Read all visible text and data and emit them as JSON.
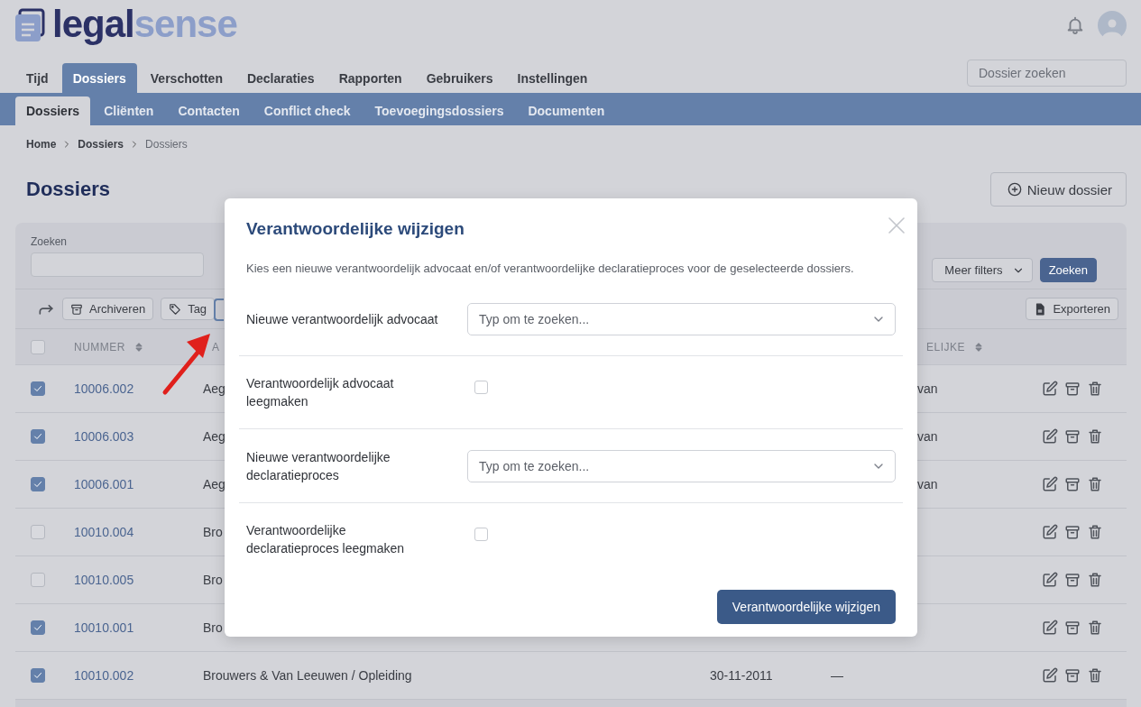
{
  "header": {
    "logo": {
      "text_1": "legal",
      "text_2": "sense"
    },
    "search": {
      "placeholder": "Dossier zoeken"
    }
  },
  "main_nav": [
    {
      "label": "Tijd",
      "selected": false
    },
    {
      "label": "Dossiers",
      "selected": true
    },
    {
      "label": "Verschotten",
      "selected": false
    },
    {
      "label": "Declaraties",
      "selected": false
    },
    {
      "label": "Rapporten",
      "selected": false
    },
    {
      "label": "Gebruikers",
      "selected": false
    },
    {
      "label": "Instellingen",
      "selected": false
    }
  ],
  "sub_nav": [
    {
      "label": "Dossiers",
      "selected": true
    },
    {
      "label": "Cliënten",
      "selected": false
    },
    {
      "label": "Contacten",
      "selected": false
    },
    {
      "label": "Conflict check",
      "selected": false
    },
    {
      "label": "Toevoegingsdossiers",
      "selected": false
    },
    {
      "label": "Documenten",
      "selected": false
    }
  ],
  "breadcrumb": [
    {
      "label": "Home",
      "current": false
    },
    {
      "label": "Dossiers",
      "current": false
    },
    {
      "label": "Dossiers",
      "current": true
    }
  ],
  "page": {
    "title": "Dossiers",
    "new_button": "Nieuw dossier"
  },
  "filters": {
    "search_label": "Zoeken",
    "more_filters": "Meer filters",
    "search_button": "Zoeken"
  },
  "toolbar": {
    "buttons": [
      {
        "kind": "archive",
        "label": "Archiveren"
      },
      {
        "kind": "tag",
        "label": "Tag"
      }
    ],
    "export": "Exporteren"
  },
  "table": {
    "all_checked": false,
    "columns": [
      {
        "label": "NUMMER",
        "sortable": true
      },
      {
        "label": "A",
        "sortable": false
      },
      {
        "label": "ELIJKE",
        "sortable": true
      }
    ],
    "rows": [
      {
        "checked": true,
        "number": "10006.002",
        "column_2": "Aeg",
        "column_4": "van"
      },
      {
        "checked": true,
        "number": "10006.003",
        "column_2": "Aeg",
        "column_4": "van"
      },
      {
        "checked": true,
        "number": "10006.001",
        "column_2": "Aeg",
        "column_4": "van"
      },
      {
        "checked": false,
        "number": "10010.004",
        "column_2": "Bro"
      },
      {
        "checked": false,
        "number": "10010.005",
        "column_2": "Bro"
      },
      {
        "checked": true,
        "number": "10010.001",
        "column_2": "Bro"
      },
      {
        "checked": true,
        "number": "10010.002",
        "column_2": "Brouwers & Van Leeuwen / Opleiding",
        "column_3": "30-11-2011",
        "column_4": "—"
      }
    ]
  },
  "modal": {
    "title": "Verantwoordelijke wijzigen",
    "description": "Kies een nieuwe verantwoordelijk advocaat en/of verantwoordelijke declaratieproces voor de geselecteerde dossiers.",
    "fields": [
      {
        "kind": "select",
        "label": "Nieuwe verantwoordelijk advocaat",
        "placeholder": "Typ om te zoeken..."
      },
      {
        "kind": "checkbox",
        "label": "Verantwoordelijk advocaat leegmaken",
        "checked": false
      },
      {
        "kind": "select",
        "label": "Nieuwe verantwoordelijke declaratieproces",
        "placeholder": "Typ om te zoeken..."
      },
      {
        "kind": "checkbox",
        "label": "Verantwoordelijke declaratieproces leegmaken",
        "checked": false
      }
    ],
    "submit": "Verantwoordelijke wijzigen"
  }
}
